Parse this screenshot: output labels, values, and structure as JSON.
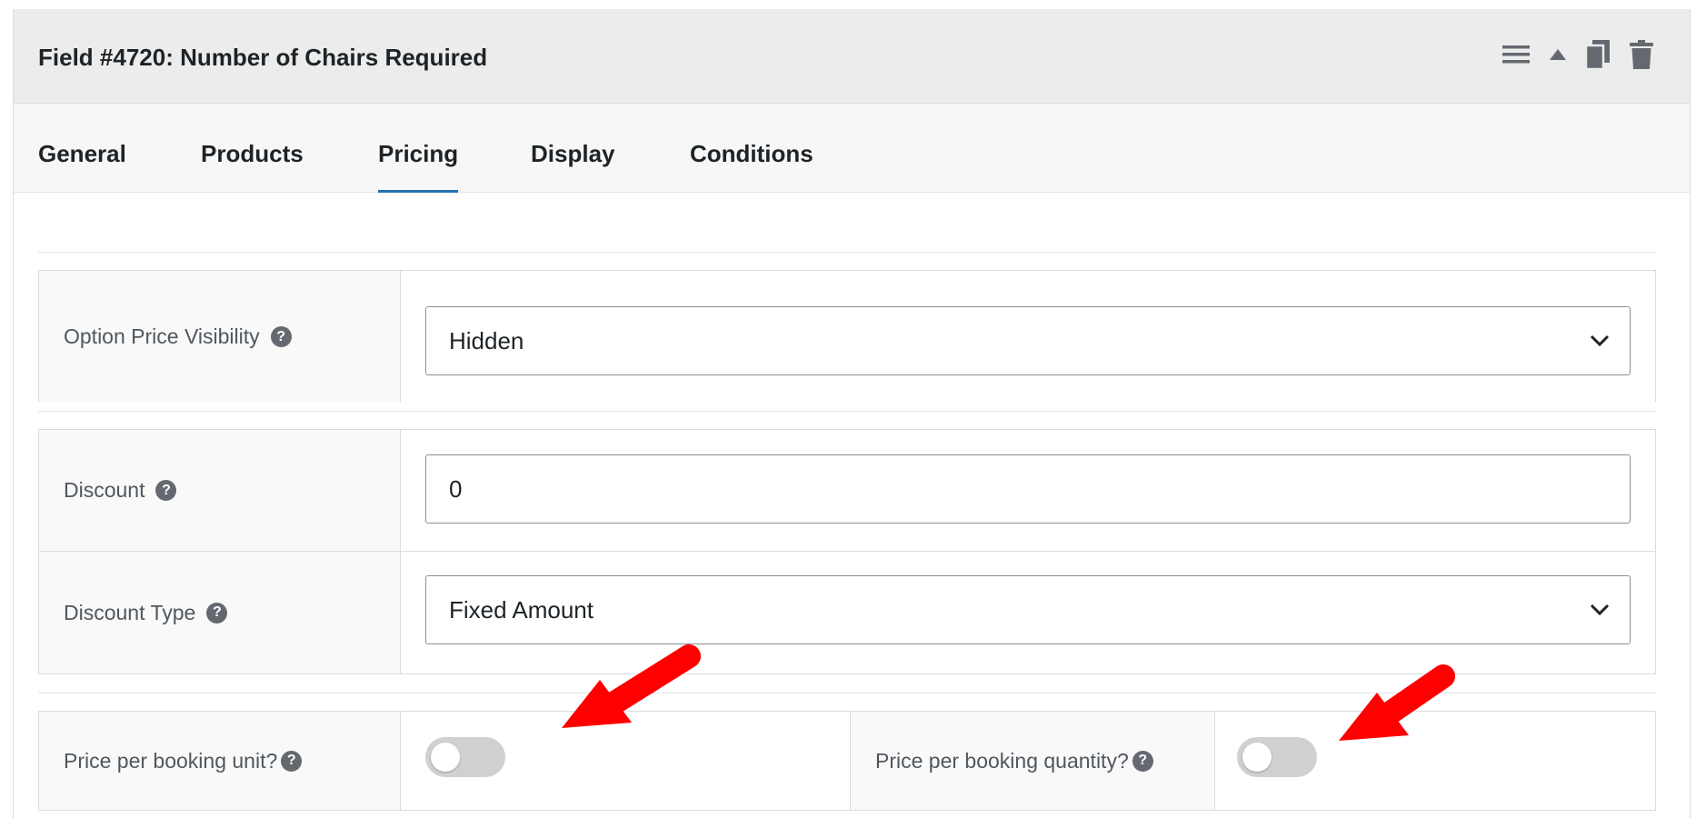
{
  "header": {
    "title": "Field #4720: Number of Chairs Required"
  },
  "tabs": [
    {
      "label": "General",
      "active": false
    },
    {
      "label": "Products",
      "active": false
    },
    {
      "label": "Pricing",
      "active": true
    },
    {
      "label": "Display",
      "active": false
    },
    {
      "label": "Conditions",
      "active": false
    }
  ],
  "fields": {
    "visibility": {
      "label": "Option Price Visibility",
      "value": "Hidden"
    },
    "discount": {
      "label": "Discount",
      "value": "0"
    },
    "discount_type": {
      "label": "Discount Type",
      "value": "Fixed Amount"
    },
    "price_per_unit": {
      "label": "Price per booking unit?",
      "enabled": false
    },
    "price_per_quantity": {
      "label": "Price per booking quantity?",
      "enabled": false
    }
  },
  "colors": {
    "accent": "#2271b1",
    "annotation_arrow": "#ff0000"
  },
  "icons": [
    "menu-icon",
    "collapse-arrow-icon",
    "duplicate-icon",
    "trash-icon",
    "help-icon",
    "chevron-down-icon"
  ]
}
